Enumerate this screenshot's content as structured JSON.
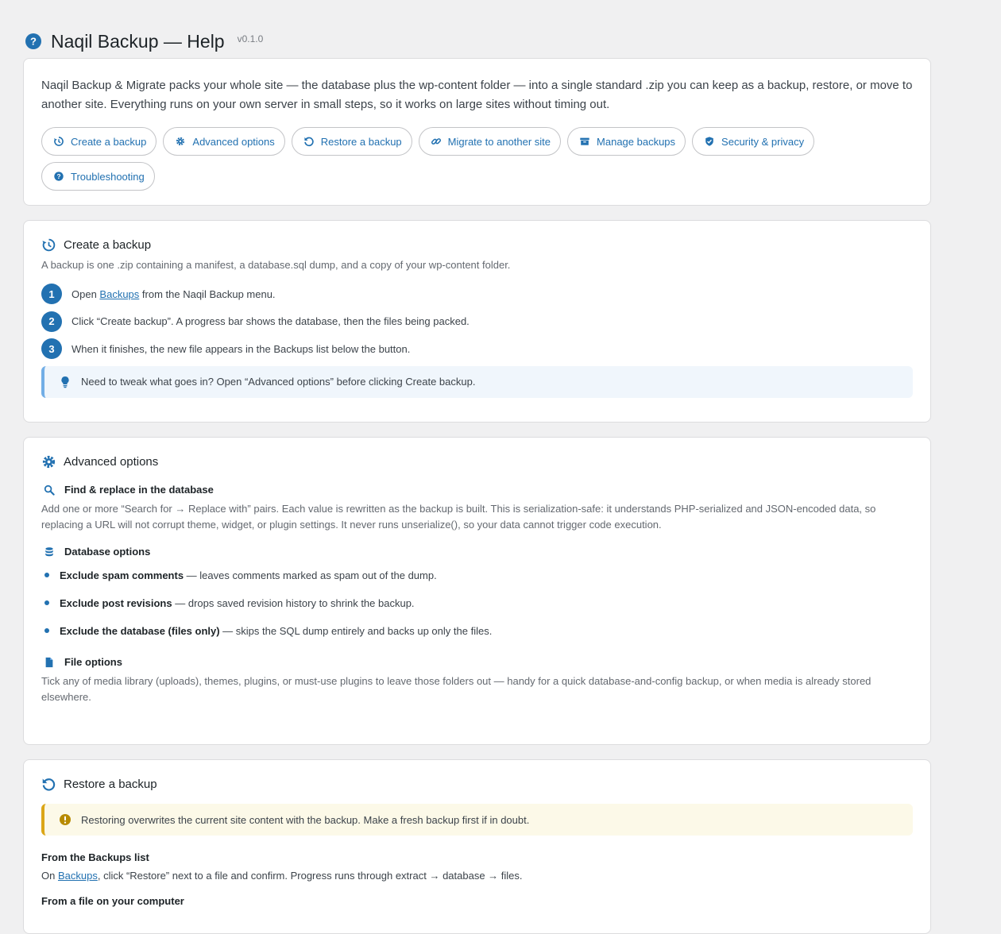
{
  "header": {
    "title": "Naqil Backup — Help",
    "version": "v0.1.0"
  },
  "intro": {
    "text": "Naqil Backup & Migrate packs your whole site — the database plus the wp-content folder — into a single standard .zip you can keep as a backup, restore, or move to another site. Everything runs on your own server in small steps, so it works on large sites without timing out.",
    "nav": [
      {
        "label": "Create a backup",
        "icon": "history-icon"
      },
      {
        "label": "Advanced options",
        "icon": "gear-icon"
      },
      {
        "label": "Restore a backup",
        "icon": "restore-icon"
      },
      {
        "label": "Migrate to another site",
        "icon": "link-icon"
      },
      {
        "label": "Manage backups",
        "icon": "archive-icon"
      },
      {
        "label": "Security & privacy",
        "icon": "shield-icon"
      },
      {
        "label": "Troubleshooting",
        "icon": "question-icon"
      }
    ]
  },
  "create": {
    "title": "Create a backup",
    "desc": "A backup is one .zip containing a manifest, a database.sql dump, and a copy of your wp-content folder.",
    "steps": [
      {
        "num": "1",
        "pre": "Open ",
        "link": "Backups",
        "post": " from the Naqil Backup menu."
      },
      {
        "num": "2",
        "text": "Click “Create backup”. A progress bar shows the database, then the files being packed."
      },
      {
        "num": "3",
        "text": "When it finishes, the new file appears in the Backups list below the button."
      }
    ],
    "tip": "Need to tweak what goes in? Open “Advanced options” before clicking Create backup."
  },
  "advanced": {
    "title": "Advanced options",
    "find_title": "Find & replace in the database",
    "find_text": "Add one or more “Search for → Replace with” pairs. Each value is rewritten as the backup is built. This is serialization-safe: it understands PHP-serialized and JSON-encoded data, so replacing a URL will not corrupt theme, widget, or plugin settings. It never runs unserialize(), so your data cannot trigger code execution.",
    "db_title": "Database options",
    "db_items": [
      {
        "bold": "Exclude spam comments",
        "rest": " — leaves comments marked as spam out of the dump."
      },
      {
        "bold": "Exclude post revisions",
        "rest": " — drops saved revision history to shrink the backup."
      },
      {
        "bold": "Exclude the database (files only)",
        "rest": " — skips the SQL dump entirely and backs up only the files."
      }
    ],
    "file_title": "File options",
    "file_text": "Tick any of media library (uploads), themes, plugins, or must-use plugins to leave those folders out — handy for a quick database-and-config backup, or when media is already stored elsewhere."
  },
  "restore": {
    "title": "Restore a backup",
    "warning": "Restoring overwrites the current site content with the backup. Make a fresh backup first if in doubt.",
    "list_title": "From the Backups list",
    "list_pre": "On ",
    "list_link": "Backups",
    "list_post": ", click “Restore” next to a file and confirm. Progress runs through extract → database → files.",
    "file_title": "From a file on your computer"
  },
  "colors": {
    "accent": "#2271b1",
    "info_border": "#72aee6",
    "warn_border": "#dba617"
  }
}
